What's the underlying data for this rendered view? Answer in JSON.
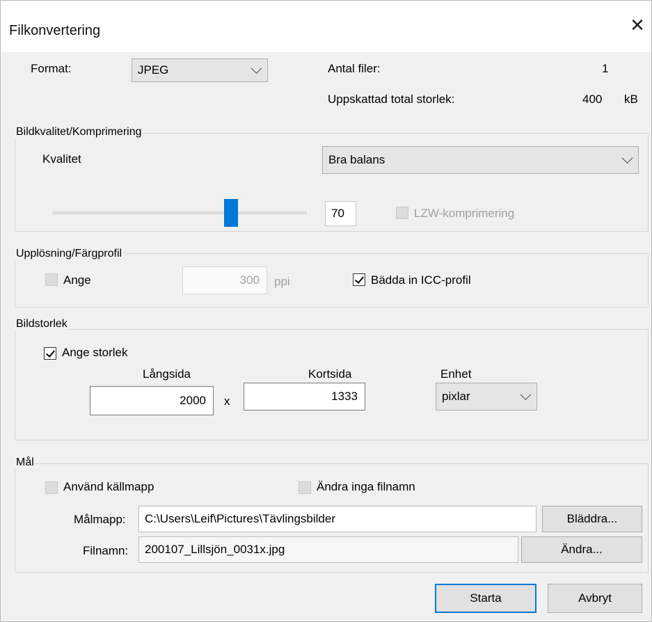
{
  "window": {
    "title": "Filkonvertering"
  },
  "format": {
    "label": "Format:",
    "value": "JPEG",
    "file_count_label": "Antal filer:",
    "file_count": "1",
    "est_size_label": "Uppskattad total storlek:",
    "est_size": "400",
    "est_size_unit": "kB"
  },
  "quality": {
    "group_label": "Bildkvalitet/Komprimering",
    "label": "Kvalitet",
    "preset": "Bra balans",
    "value": "70",
    "slider_fraction": 0.7,
    "lzw_label": "LZW-komprimering"
  },
  "resolution": {
    "group_label": "Upplösning/Färgprofil",
    "set_label": "Ange",
    "ppi_value": "300",
    "ppi_unit": "ppi",
    "icc_label": "Bädda in ICC-profil"
  },
  "size": {
    "group_label": "Bildstorlek",
    "set_size_label": "Ange storlek",
    "long_label": "Långsida",
    "long_value": "2000",
    "x_label": "x",
    "short_label": "Kortsida",
    "short_value": "1333",
    "unit_label": "Enhet",
    "unit_value": "pixlar"
  },
  "target": {
    "group_label": "Mål",
    "use_source_label": "Använd källmapp",
    "no_rename_label": "Ändra inga filnamn",
    "folder_label": "Målmapp:",
    "folder_value": "C:\\Users\\Leif\\Pictures\\Tävlingsbilder",
    "browse_label": "Bläddra...",
    "filename_label": "Filnamn:",
    "filename_value": "200107_Lillsjön_0031x.jpg",
    "change_label": "Ändra..."
  },
  "buttons": {
    "start": "Starta",
    "cancel": "Avbryt"
  },
  "colors": {
    "accent": "#0078d7",
    "dialog_bg": "#f0f0f0"
  }
}
